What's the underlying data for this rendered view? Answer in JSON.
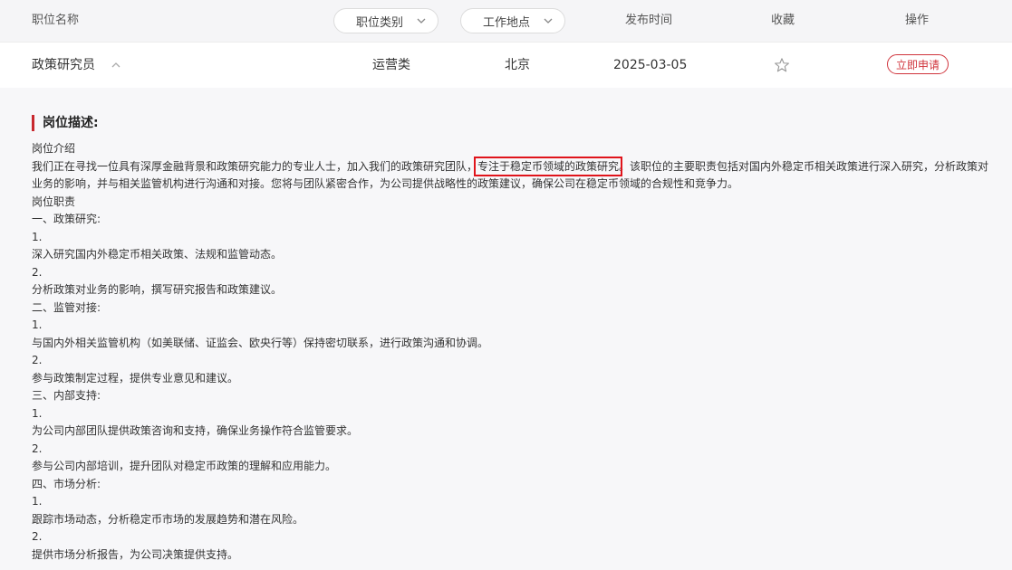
{
  "header": {
    "col_title": "职位名称",
    "filter_category": "职位类别",
    "filter_location": "工作地点",
    "col_date": "发布时间",
    "col_favorite": "收藏",
    "col_action": "操作"
  },
  "job": {
    "title": "政策研究员",
    "category": "运营类",
    "location": "北京",
    "date": "2025-03-05",
    "apply_label": "立即申请"
  },
  "detail": {
    "heading": "岗位描述:",
    "intro_heading": "岗位介绍",
    "intro_before": "我们正在寻找一位具有深厚金融背景和政策研究能力的专业人士，加入我们的政策研究团队，",
    "intro_highlight": "专注于稳定币领域的政策研究",
    "intro_after": "。该职位的主要职责包括对国内外稳定币相关政策进行深入研究，分析政策对业务的影响，并与相关监管机构进行沟通和对接。您将与团队紧密合作，为公司提供战略性的政策建议，确保公司在稳定币领域的合规性和竞争力。",
    "lines": [
      "岗位职责",
      "一、政策研究:",
      "1.",
      "深入研究国内外稳定币相关政策、法规和监管动态。",
      "2.",
      "分析政策对业务的影响，撰写研究报告和政策建议。",
      "二、监管对接:",
      "1.",
      "与国内外相关监管机构（如美联储、证监会、欧央行等）保持密切联系，进行政策沟通和协调。",
      "2.",
      "参与政策制定过程，提供专业意见和建议。",
      "三、内部支持:",
      "1.",
      "为公司内部团队提供政策咨询和支持，确保业务操作符合监管要求。",
      "2.",
      "参与公司内部培训，提升团队对稳定币政策的理解和应用能力。",
      "四、市场分析:",
      "1.",
      "跟踪市场动态，分析稳定币市场的发展趋势和潜在风险。",
      "2.",
      "提供市场分析报告，为公司决策提供支持。"
    ]
  },
  "colors": {
    "accent": "#d0343c",
    "highlight_box": "#e0141b",
    "header_bg": "#f5f5f7",
    "detail_bg": "#f7f7f9"
  },
  "icons": [
    "chevron-down-icon",
    "chevron-up-icon",
    "star-outline-icon"
  ]
}
